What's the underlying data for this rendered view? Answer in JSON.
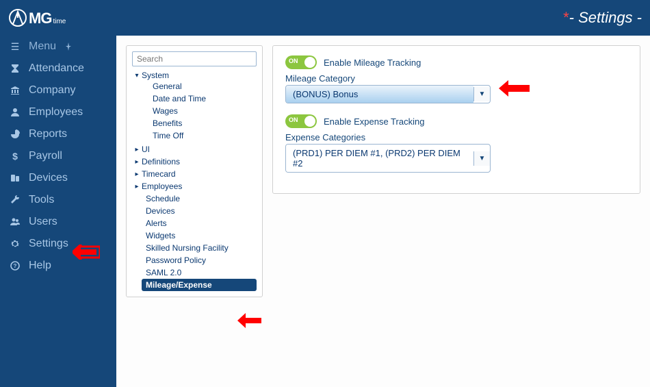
{
  "header": {
    "logo_main": "MG",
    "logo_sub": "time",
    "page_title": "- Settings -",
    "asterisk": "*"
  },
  "sidebar": {
    "items": [
      {
        "label": "Menu"
      },
      {
        "label": "Attendance"
      },
      {
        "label": "Company"
      },
      {
        "label": "Employees"
      },
      {
        "label": "Reports"
      },
      {
        "label": "Payroll"
      },
      {
        "label": "Devices"
      },
      {
        "label": "Tools"
      },
      {
        "label": "Users"
      },
      {
        "label": "Settings"
      },
      {
        "label": "Help"
      }
    ]
  },
  "tree": {
    "search_placeholder": "Search",
    "system": {
      "label": "System",
      "children": [
        "General",
        "Date and Time",
        "Wages",
        "Benefits",
        "Time Off"
      ]
    },
    "nodes": [
      "UI",
      "Definitions",
      "Timecard",
      "Employees"
    ],
    "loose": [
      "Schedule",
      "Devices",
      "Alerts",
      "Widgets",
      "Skilled Nursing Facility",
      "Password Policy",
      "SAML 2.0"
    ],
    "active": "Mileage/Expense"
  },
  "content": {
    "mileage_toggle": {
      "on": "ON",
      "label": "Enable Mileage Tracking"
    },
    "mileage_category_label": "Mileage Category",
    "mileage_category_value": "(BONUS) Bonus",
    "expense_toggle": {
      "on": "ON",
      "label": "Enable Expense Tracking"
    },
    "expense_categories_label": "Expense Categories",
    "expense_categories_value": "(PRD1) PER DIEM #1, (PRD2) PER DIEM #2"
  }
}
